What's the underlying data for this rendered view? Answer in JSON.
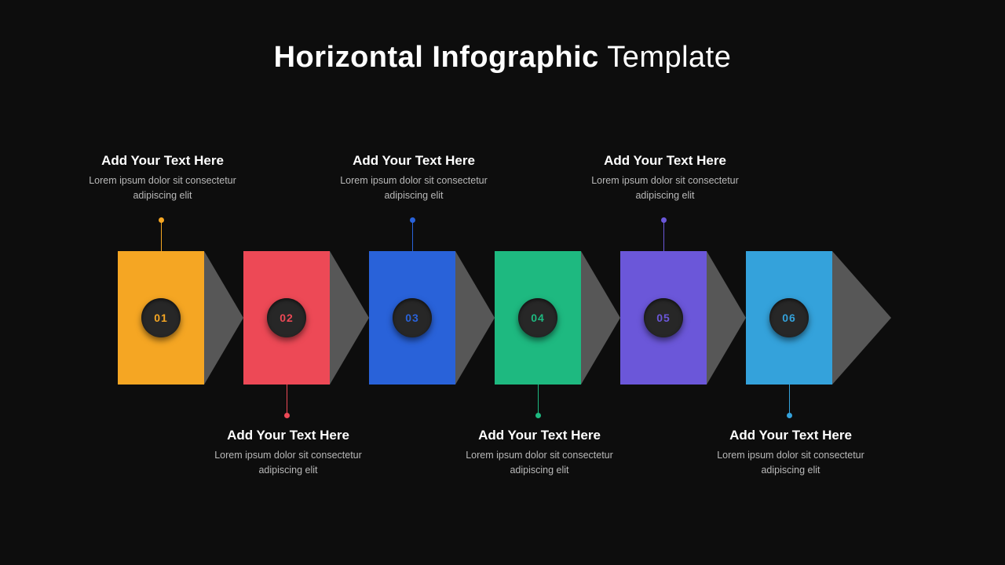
{
  "title": {
    "bold": "Horizontal Infographic",
    "light": "Template"
  },
  "steps": [
    {
      "num": "01",
      "color": "#f5a623",
      "pos": "top",
      "heading": "Add Your Text Here",
      "body": "Lorem ipsum dolor sit consectetur adipiscing elit"
    },
    {
      "num": "02",
      "color": "#ed4956",
      "pos": "bottom",
      "heading": "Add Your Text Here",
      "body": "Lorem ipsum dolor sit consectetur adipiscing elit"
    },
    {
      "num": "03",
      "color": "#2962d9",
      "pos": "top",
      "heading": "Add Your Text Here",
      "body": "Lorem ipsum dolor sit consectetur adipiscing elit"
    },
    {
      "num": "04",
      "color": "#1eb980",
      "pos": "bottom",
      "heading": "Add Your Text Here",
      "body": "Lorem ipsum dolor sit consectetur adipiscing elit"
    },
    {
      "num": "05",
      "color": "#6b57d9",
      "pos": "top",
      "heading": "Add Your Text Here",
      "body": "Lorem ipsum dolor sit consectetur adipiscing elit"
    },
    {
      "num": "06",
      "color": "#34a2db",
      "pos": "bottom",
      "heading": "Add Your Text Here",
      "body": "Lorem ipsum dolor sit consectetur adipiscing elit"
    }
  ]
}
